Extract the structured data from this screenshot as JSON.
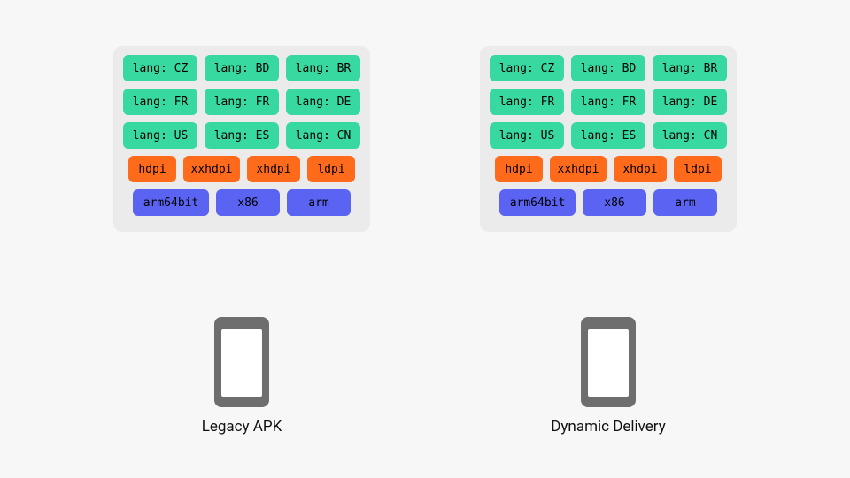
{
  "colors": {
    "lang": "#37d9a1",
    "dpi": "#ff6b1a",
    "arch": "#5a63f2",
    "panel": "#ebebeb",
    "bg": "#f7f7f7"
  },
  "left": {
    "langs": [
      [
        "lang: CZ",
        "lang: BD",
        "lang: BR"
      ],
      [
        "lang: FR",
        "lang: FR",
        "lang: DE"
      ],
      [
        "lang: US",
        "lang: ES",
        "lang: CN"
      ]
    ],
    "dpis": [
      "hdpi",
      "xxhdpi",
      "xhdpi",
      "ldpi"
    ],
    "archs": [
      "arm64bit",
      "x86",
      "arm"
    ],
    "caption": "Legacy APK"
  },
  "right": {
    "langs": [
      [
        "lang: CZ",
        "lang: BD",
        "lang: BR"
      ],
      [
        "lang: FR",
        "lang: FR",
        "lang: DE"
      ],
      [
        "lang: US",
        "lang: ES",
        "lang: CN"
      ]
    ],
    "dpis": [
      "hdpi",
      "xxhdpi",
      "xhdpi",
      "ldpi"
    ],
    "archs": [
      "arm64bit",
      "x86",
      "arm"
    ],
    "caption": "Dynamic Delivery"
  }
}
